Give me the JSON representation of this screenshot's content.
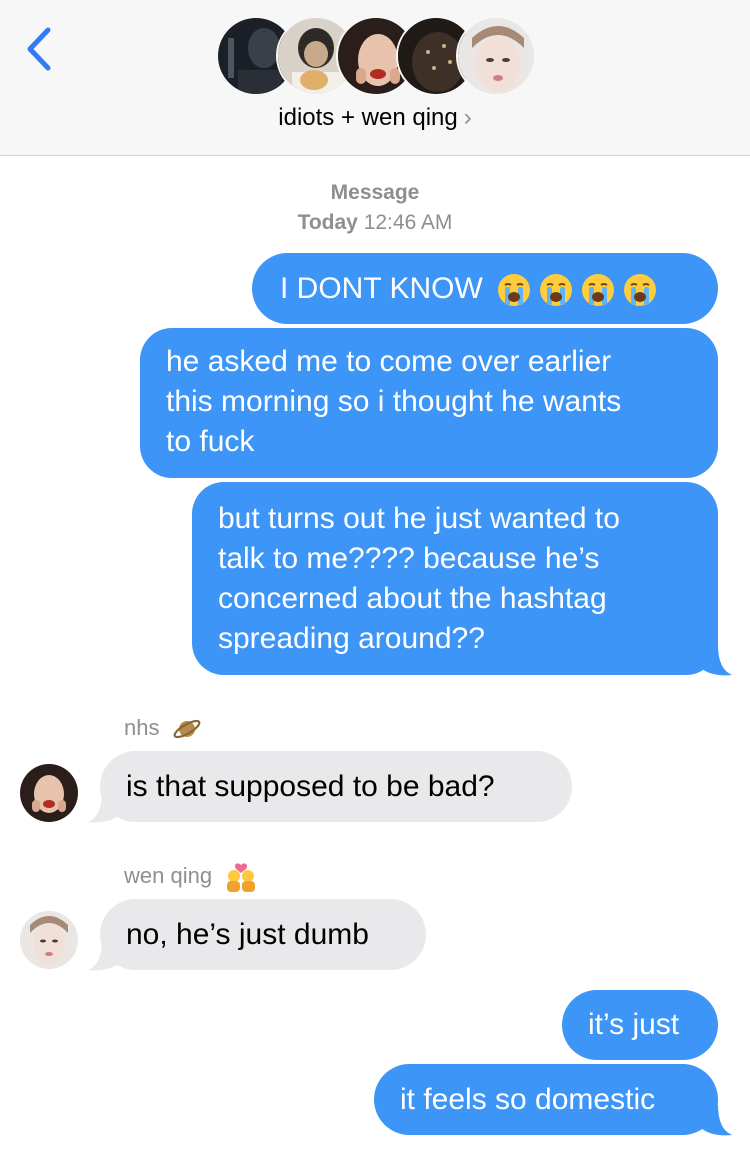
{
  "header": {
    "title": "idiots + wen qing",
    "title_chevron": "›",
    "back_icon": "chevron-left-icon"
  },
  "timestamp": {
    "service": "Message",
    "day": "Today",
    "time": "12:46 AM"
  },
  "messages": [
    {
      "text": "I DONT KNOW",
      "emoji": "😭😭😭😭"
    },
    {
      "text_lines": [
        "he asked me to come over earlier",
        "this morning so i thought he wants",
        "to fuck"
      ]
    },
    {
      "text_lines": [
        "but turns out he just wanted to",
        "talk to me???? because he’s",
        "concerned about the hashtag",
        "spreading around??"
      ]
    },
    {
      "sender": "nhs",
      "sender_emoji": "🪐",
      "text": "is that supposed to be bad?"
    },
    {
      "sender": "wen qing",
      "sender_emoji": "💏",
      "text": "no, he’s just dumb"
    },
    {
      "text": "it’s just"
    },
    {
      "text": "it feels so domestic"
    }
  ],
  "colors": {
    "outgoing": "#3d95f7",
    "incoming": "#e9e9eb",
    "accent": "#2f7cf6",
    "meta": "#8e8e93"
  }
}
